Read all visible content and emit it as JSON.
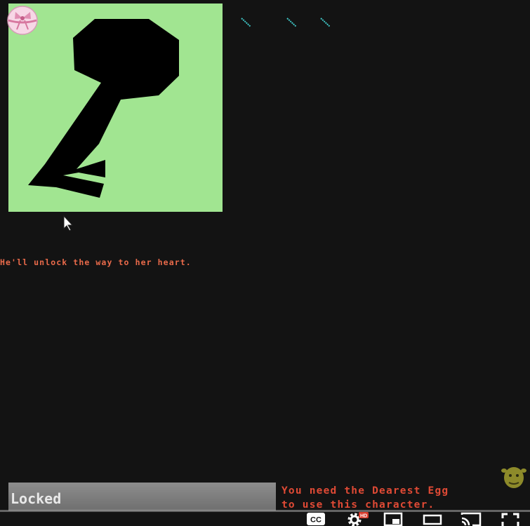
{
  "game": {
    "flavor_text": "He'll unlock the way to her heart.",
    "locked_label": "Locked",
    "requirement_line1": "You need the Dearest Egg",
    "requirement_line2": "to use this character.",
    "portrait_icon": "key-icon",
    "badge_icon": "egg-with-bow-icon"
  },
  "player": {
    "cc_label": "CC",
    "hd_badge": "HD",
    "icons": [
      "cc-icon",
      "settings-icon",
      "miniplayer-icon",
      "theater-mode-icon",
      "cast-icon",
      "fullscreen-icon"
    ]
  },
  "colors": {
    "background": "#131313",
    "portrait_bg": "#a1e591",
    "text_orange": "#e96a4a",
    "text_red": "#e04a35",
    "accent_cyan": "#3fc6c6"
  }
}
